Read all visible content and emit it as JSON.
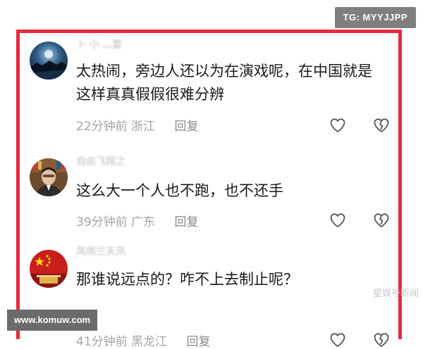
{
  "badges": {
    "tg": "TG: MYYJJPP",
    "site": "www.komuw.com",
    "watermark": "星娱号新闻"
  },
  "comments": [
    {
      "username": "卜 小 灬雷",
      "text": "太热闹，旁边人还以为在演戏呢，在中国就是这样真真假假很难分辨",
      "time": "22分钟前",
      "location": "浙江",
      "reply_label": "回复",
      "avatar_icon": "night-landscape-avatar-icon"
    },
    {
      "username": "自由飞翔之",
      "text": "这么大一个人也不跑，也不还手",
      "time": "39分钟前",
      "location": "广东",
      "reply_label": "回复",
      "avatar_icon": "man-portrait-avatar-icon"
    },
    {
      "username": "风雨兰天凤",
      "text": "那谁说远点的？咋不上去制止呢？",
      "time": "41分钟前",
      "location": "黑龙江",
      "reply_label": "回复",
      "avatar_icon": "flag-avatar-icon"
    }
  ],
  "colors": {
    "frame_border": "#e8293f",
    "text": "#1a1a1a",
    "meta": "#a4a4a4"
  }
}
